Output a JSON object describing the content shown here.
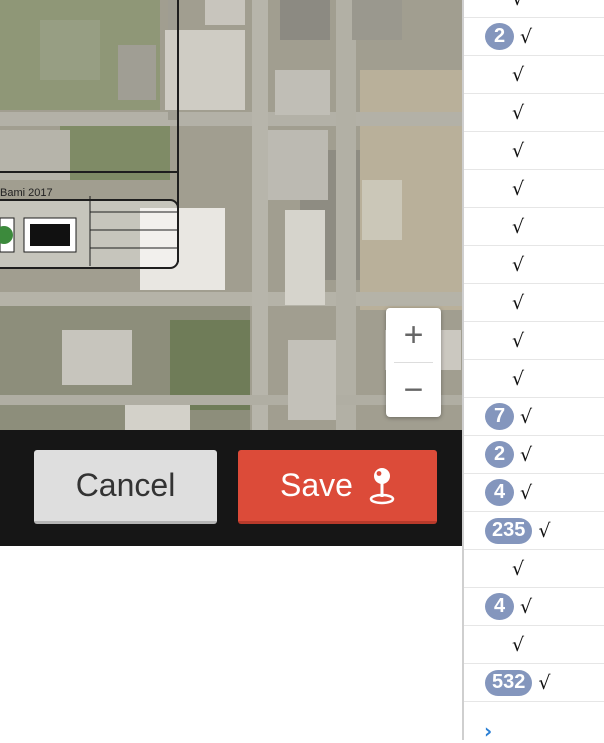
{
  "map": {
    "overlay_text": "Bami 2017",
    "zoom_in_label": "+",
    "zoom_out_label": "−"
  },
  "actions": {
    "cancel_label": "Cancel",
    "save_label": "Save"
  },
  "panel": {
    "check_mark": "√",
    "rows": [
      {
        "badge": ""
      },
      {
        "badge": "2"
      },
      {
        "badge": ""
      },
      {
        "badge": ""
      },
      {
        "badge": ""
      },
      {
        "badge": ""
      },
      {
        "badge": ""
      },
      {
        "badge": ""
      },
      {
        "badge": ""
      },
      {
        "badge": ""
      },
      {
        "badge": ""
      },
      {
        "badge": "7"
      },
      {
        "badge": "2"
      },
      {
        "badge": "4"
      },
      {
        "badge": "235"
      },
      {
        "badge": ""
      },
      {
        "badge": "4"
      },
      {
        "badge": ""
      },
      {
        "badge": "532"
      }
    ],
    "more_icon": "chevron-right-icon",
    "more_glyph": "›"
  },
  "colors": {
    "save": "#dc4b39",
    "cancel": "#dedede",
    "badge": "#8496bd",
    "bar": "#161616"
  }
}
